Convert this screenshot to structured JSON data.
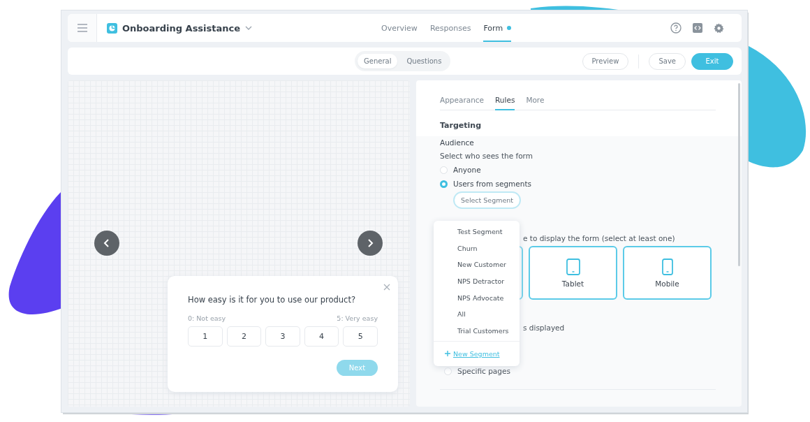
{
  "header": {
    "title": "Onboarding Assistance",
    "tabs": [
      {
        "label": "Overview",
        "selected": false,
        "dot": false
      },
      {
        "label": "Responses",
        "selected": false,
        "dot": false
      },
      {
        "label": "Form",
        "selected": true,
        "dot": true
      }
    ]
  },
  "toolbar": {
    "views": [
      {
        "label": "General",
        "selected": true
      },
      {
        "label": "Questions",
        "selected": false
      }
    ],
    "buttons": [
      {
        "label": "Preview",
        "kind": "outline"
      },
      {
        "label": "Save",
        "kind": "outline"
      },
      {
        "label": "Exit",
        "kind": "primary"
      }
    ]
  },
  "preview": {
    "question": "How easy is it for you to use our product?",
    "low_label": "0: Not easy",
    "high_label": "5: Very easy",
    "options": [
      "1",
      "2",
      "3",
      "4",
      "5"
    ],
    "next": "Next"
  },
  "settings": {
    "tabs": [
      {
        "label": "Appearance",
        "selected": false
      },
      {
        "label": "Rules",
        "selected": true
      },
      {
        "label": "More",
        "selected": false
      }
    ],
    "heading": "Targeting",
    "audience_label": "Audience",
    "audience_hint": "Select who sees the form",
    "audience_options": [
      {
        "label": "Anyone",
        "selected": false
      },
      {
        "label": "Users from segments",
        "selected": true
      }
    ],
    "segment_button": "Select Segment",
    "device_hint": "e to display the form (select at least one)",
    "devices": [
      {
        "label": "Tablet",
        "kind": "tablet"
      },
      {
        "label": "Mobile",
        "kind": "mobile"
      }
    ],
    "pages_hint": "s displayed",
    "page_options": [
      {
        "label": "Specific pages",
        "selected": false
      }
    ]
  },
  "segment_menu": {
    "items": [
      "Test Segment",
      "Churn",
      "New Customer",
      "NPS Detractor",
      "NPS Advocate",
      "All",
      "Trial Customers"
    ],
    "add": "New Segment"
  }
}
